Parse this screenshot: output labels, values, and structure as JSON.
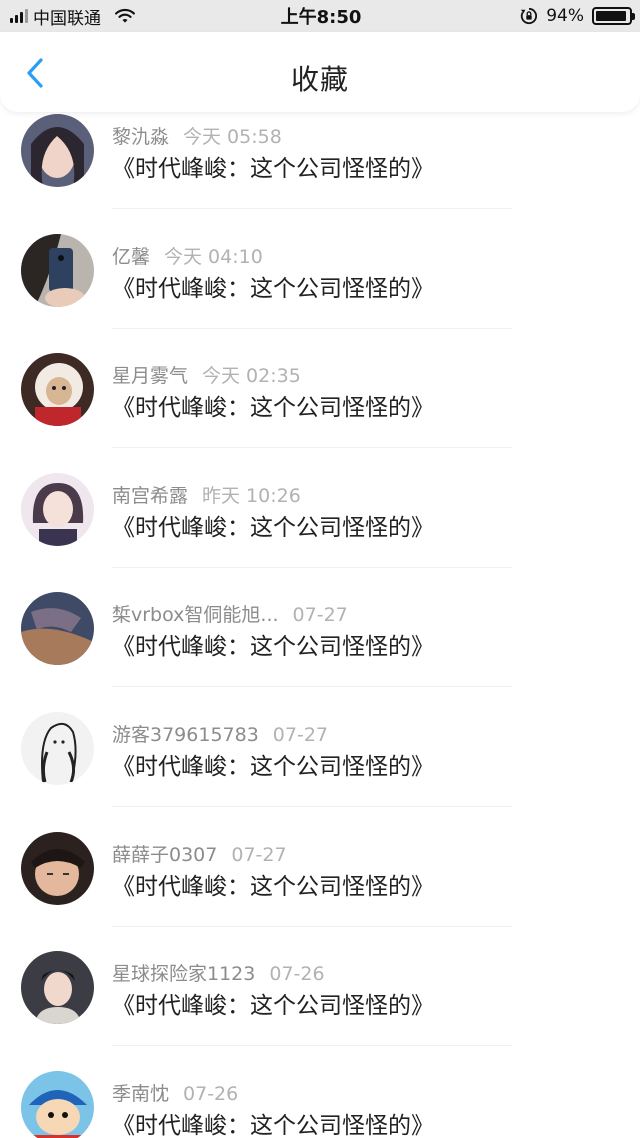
{
  "status_bar": {
    "carrier": "中国联通",
    "time": "上午8:50",
    "battery": "94%",
    "battery_level": 0.94,
    "icons": [
      "signal-icon",
      "wifi-icon",
      "rotation-lock-icon",
      "battery-icon"
    ]
  },
  "nav": {
    "title": "收藏",
    "back_icon": "chevron-left-icon",
    "accent_color": "#2a9df4"
  },
  "items": [
    {
      "name": "黎氿淼",
      "time": "今天 05:58",
      "title": "《时代峰峻：这个公司怪怪的》"
    },
    {
      "name": "亿馨",
      "time": "今天 04:10",
      "title": "《时代峰峻：这个公司怪怪的》"
    },
    {
      "name": "星月雾气",
      "time": "今天 02:35",
      "title": "《时代峰峻：这个公司怪怪的》"
    },
    {
      "name": "南宫希露",
      "time": "昨天 10:26",
      "title": "《时代峰峻：这个公司怪怪的》"
    },
    {
      "name": "椞vrbox智侗能旭...",
      "time": "07-27",
      "title": "《时代峰峻：这个公司怪怪的》"
    },
    {
      "name": "游客379615783",
      "time": "07-27",
      "title": "《时代峰峻：这个公司怪怪的》"
    },
    {
      "name": "薛薛子0307",
      "time": "07-27",
      "title": "《时代峰峻：这个公司怪怪的》"
    },
    {
      "name": "星球探险家1123",
      "time": "07-26",
      "title": "《时代峰峻：这个公司怪怪的》"
    },
    {
      "name": "季南忱",
      "time": "07-26",
      "title": "《时代峰峻：这个公司怪怪的》"
    }
  ]
}
